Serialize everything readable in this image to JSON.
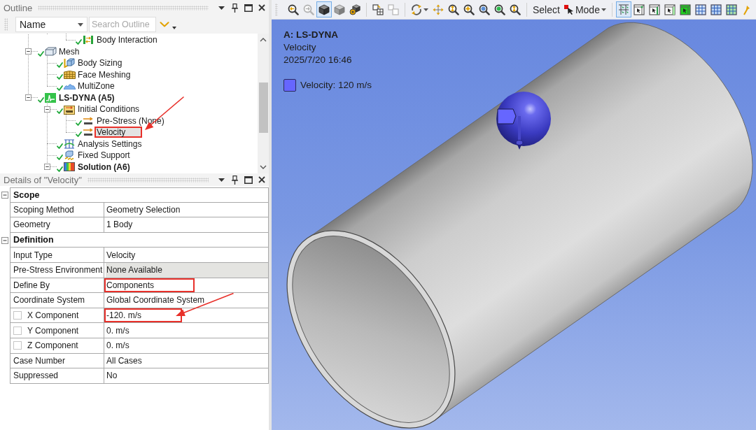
{
  "outline": {
    "title": "Outline",
    "filter": {
      "column": "Name",
      "placeholder": "Search Outline"
    },
    "tree": [
      {
        "children": [
          {
            "children": [
              {
                "kind": "connection",
                "label": "Body Interaction",
                "done": true,
                "selected": false,
                "highlighted": false
              }
            ]
          }
        ]
      },
      {
        "kind": "mesh",
        "label": "Mesh",
        "done": true,
        "expanded": true,
        "selected": false,
        "highlighted": false,
        "children": [
          {
            "kind": "sizing",
            "label": "Body Sizing",
            "done": true,
            "selected": false,
            "highlighted": false
          },
          {
            "kind": "face-meshing",
            "label": "Face Meshing",
            "done": true,
            "selected": false,
            "highlighted": false
          },
          {
            "kind": "multizone",
            "label": "MultiZone",
            "done": true,
            "selected": false,
            "highlighted": false
          }
        ]
      },
      {
        "kind": "analysis",
        "label": "LS-DYNA (A5)",
        "done": true,
        "expanded": true,
        "selected": false,
        "highlighted": false,
        "children": [
          {
            "kind": "initial-conditions",
            "label": "Initial Conditions",
            "done": true,
            "expanded": true,
            "selected": false,
            "highlighted": false,
            "children": [
              {
                "kind": "initial-value",
                "label": "Pre-Stress (None)",
                "done": true,
                "selected": false,
                "highlighted": false
              },
              {
                "kind": "initial-value",
                "label": "Velocity",
                "done": true,
                "selected": true,
                "highlighted": true
              }
            ]
          },
          {
            "kind": "analysis-settings",
            "label": "Analysis Settings",
            "done": true,
            "selected": false,
            "highlighted": false
          },
          {
            "kind": "support",
            "label": "Fixed Support",
            "done": true,
            "selected": false,
            "highlighted": false
          },
          {
            "kind": "solution",
            "label": "Solution (A6)",
            "done": true,
            "expanded": true,
            "selected": false,
            "highlighted": false
          }
        ]
      }
    ]
  },
  "details": {
    "title": "Details of \"Velocity\"",
    "sections": [
      {
        "title": "Scope",
        "expanded": true,
        "rows": [
          {
            "kind": "plain",
            "label": "Scoping Method",
            "value": "Geometry Selection",
            "readonly": false,
            "highlighted": false
          },
          {
            "kind": "plain",
            "label": "Geometry",
            "value": "1 Body",
            "readonly": false,
            "highlighted": false
          }
        ]
      },
      {
        "title": "Definition",
        "expanded": true,
        "rows": [
          {
            "kind": "plain",
            "label": "Input Type",
            "value": "Velocity",
            "readonly": false,
            "highlighted": false
          },
          {
            "kind": "plain",
            "label": "Pre-Stress Environment",
            "value": "None Available",
            "readonly": true,
            "highlighted": false
          },
          {
            "kind": "plain",
            "label": "Define By",
            "value": "Components",
            "readonly": false,
            "highlighted": true
          },
          {
            "kind": "plain",
            "label": "Coordinate System",
            "value": "Global Coordinate System",
            "readonly": false,
            "highlighted": false
          },
          {
            "kind": "checkbox",
            "checked": false,
            "label": "X Component",
            "value": "-120. m/s",
            "readonly": false,
            "highlighted": true
          },
          {
            "kind": "checkbox",
            "checked": false,
            "label": "Y Component",
            "value": "0. m/s",
            "readonly": false,
            "highlighted": false
          },
          {
            "kind": "checkbox",
            "checked": false,
            "label": "Z Component",
            "value": "0. m/s",
            "readonly": false,
            "highlighted": false
          },
          {
            "kind": "plain",
            "label": "Case Number",
            "value": "All Cases",
            "readonly": false,
            "highlighted": false
          },
          {
            "kind": "plain",
            "label": "Suppressed",
            "value": "No",
            "readonly": false,
            "highlighted": false
          }
        ]
      }
    ]
  },
  "toolbar": {
    "groups": [
      [
        {
          "kind": "zoom-back",
          "selected": false,
          "disabled": false
        },
        {
          "kind": "zoom-previous",
          "selected": false,
          "disabled": true
        },
        {
          "kind": "iso-cube",
          "selected": true,
          "disabled": false
        },
        {
          "kind": "shaded-cube",
          "selected": false,
          "disabled": false
        },
        {
          "kind": "cube-settings",
          "selected": false,
          "disabled": false
        }
      ],
      [
        {
          "kind": "box-grid",
          "selected": false,
          "disabled": false
        },
        {
          "kind": "box-outline",
          "selected": false,
          "disabled": true
        }
      ],
      [
        {
          "kind": "rotate",
          "selected": false,
          "disabled": false
        },
        {
          "kind": "pan",
          "selected": false,
          "disabled": false
        },
        {
          "kind": "zoom-fit",
          "selected": false,
          "disabled": false
        },
        {
          "kind": "zoom-in",
          "selected": false,
          "disabled": false
        },
        {
          "kind": "zoom-box",
          "selected": false,
          "disabled": false
        },
        {
          "kind": "zoom-green",
          "selected": false,
          "disabled": false
        },
        {
          "kind": "zoom-fit",
          "selected": false,
          "disabled": false
        }
      ],
      [
        {
          "kind": "select",
          "label": "Select",
          "selected": false,
          "disabled": false
        },
        {
          "kind": "mode",
          "label": "Mode",
          "selected": false,
          "disabled": false
        }
      ],
      [
        {
          "kind": "select-type",
          "selected": true,
          "disabled": false
        },
        {
          "kind": "vertex",
          "selected": false,
          "disabled": false
        },
        {
          "kind": "edge",
          "selected": false,
          "disabled": false
        },
        {
          "kind": "face",
          "selected": false,
          "disabled": false
        },
        {
          "kind": "body",
          "selected": false,
          "disabled": false
        },
        {
          "kind": "node",
          "selected": false,
          "disabled": false
        },
        {
          "kind": "element",
          "selected": false,
          "disabled": false
        },
        {
          "kind": "element-face",
          "selected": false,
          "disabled": false
        },
        {
          "kind": "coordinates",
          "selected": false,
          "disabled": false
        }
      ]
    ]
  },
  "viewport": {
    "title": "A: LS-DYNA",
    "subtitle": "Velocity",
    "timestamp": "2025/7/20 16:46",
    "legend": [
      {
        "label": "Velocity: 120 m/s",
        "color": "#6666ff"
      }
    ]
  }
}
